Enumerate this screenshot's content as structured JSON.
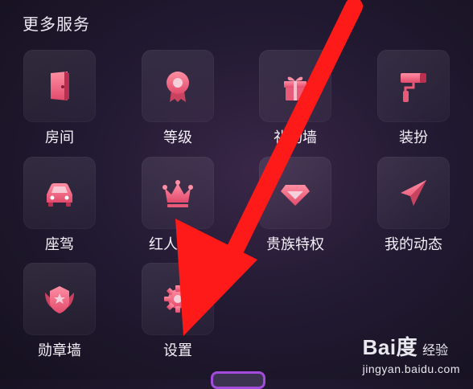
{
  "section_title": "更多服务",
  "services": [
    {
      "label": "房间",
      "icon": "door-icon"
    },
    {
      "label": "等级",
      "icon": "medal-icon"
    },
    {
      "label": "礼物墙",
      "icon": "gift-icon"
    },
    {
      "label": "装扮",
      "icon": "paint-roller-icon"
    },
    {
      "label": "座驾",
      "icon": "car-icon"
    },
    {
      "label": "红人认证",
      "icon": "crown-icon"
    },
    {
      "label": "贵族特权",
      "icon": "diamond-icon"
    },
    {
      "label": "我的动态",
      "icon": "paper-plane-icon"
    },
    {
      "label": "勋章墙",
      "icon": "badge-icon"
    },
    {
      "label": "设置",
      "icon": "gear-icon"
    }
  ],
  "watermark": {
    "brand": "Bai度",
    "suffix": "经验",
    "url": "jingyan.baidu.com"
  },
  "colors": {
    "icon_pink": "#f06a85",
    "arrow_red": "#ff1a1a",
    "background": "#241a34"
  }
}
